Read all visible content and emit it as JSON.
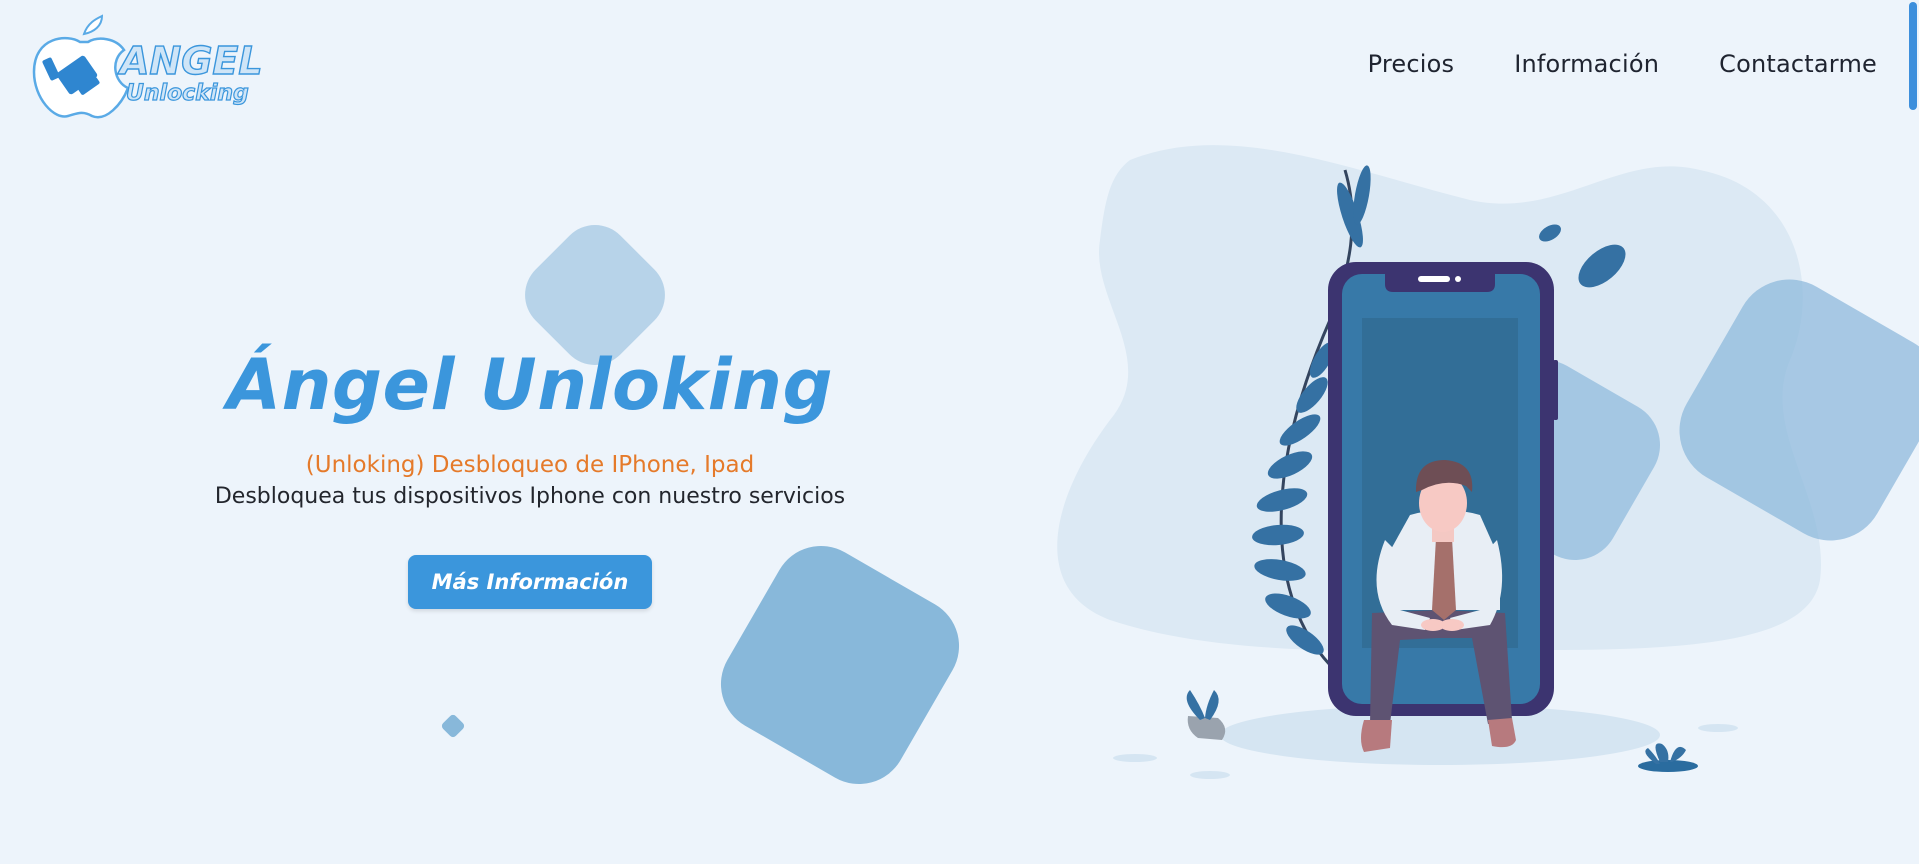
{
  "brand": {
    "logo_text_line1": "ANGEL",
    "logo_text_line2": "Unlocking"
  },
  "nav": {
    "items": [
      {
        "label": "Precios"
      },
      {
        "label": "Información"
      },
      {
        "label": "Contactarme"
      }
    ]
  },
  "hero": {
    "title": "Ángel Unloking",
    "subtitle": "(Unloking) Desbloqueo de IPhone, Ipad",
    "description": "Desbloquea tus dispositivos Iphone con nuestro servicios",
    "cta_label": "Más Información"
  },
  "colors": {
    "background": "#edf4fb",
    "accent": "#3b96dc",
    "subtitle_orange": "#e57a2a",
    "shape_light": "#b7d3e9",
    "shape_mid": "#88b8da",
    "phone_frame": "#3c3470",
    "phone_screen": "#3779a8"
  }
}
